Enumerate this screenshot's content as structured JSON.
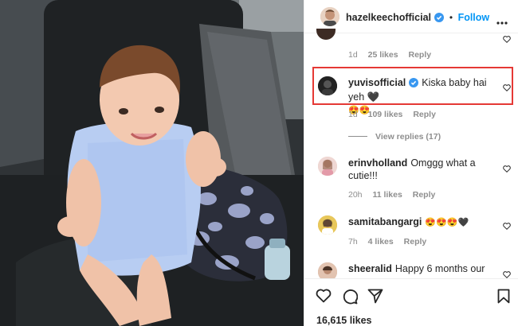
{
  "post": {
    "username": "hazelkeechofficial",
    "follow_label": "Follow",
    "separator": "•",
    "likes_count": "16,615 likes"
  },
  "comments": [
    {
      "username": "",
      "text": "",
      "time": "1d",
      "likes": "25 likes",
      "reply": "Reply"
    },
    {
      "username": "yuvisofficial",
      "text": "Kiska baby hai yeh 🖤",
      "emoji_line": "😍😍",
      "time": "1d",
      "likes": "109 likes",
      "reply": "Reply",
      "view_replies": "View replies (17)"
    },
    {
      "username": "erinvholland",
      "text": "Omggg what a",
      "text_line2": "cutie!!!",
      "time": "20h",
      "likes": "11 likes",
      "reply": "Reply"
    },
    {
      "username": "samitabangargi",
      "text": "😍😍😍🖤",
      "time": "7h",
      "likes": "4 likes",
      "reply": "Reply"
    },
    {
      "username": "sheeralid",
      "text": "Happy 6 months our"
    }
  ],
  "colors": {
    "accent": "#0095f6",
    "highlight": "#e53935",
    "muted": "#8e8e8e"
  },
  "icons": [
    "verified-badge-icon",
    "more-options-icon",
    "heart-icon",
    "comment-icon",
    "share-icon",
    "bookmark-icon"
  ]
}
